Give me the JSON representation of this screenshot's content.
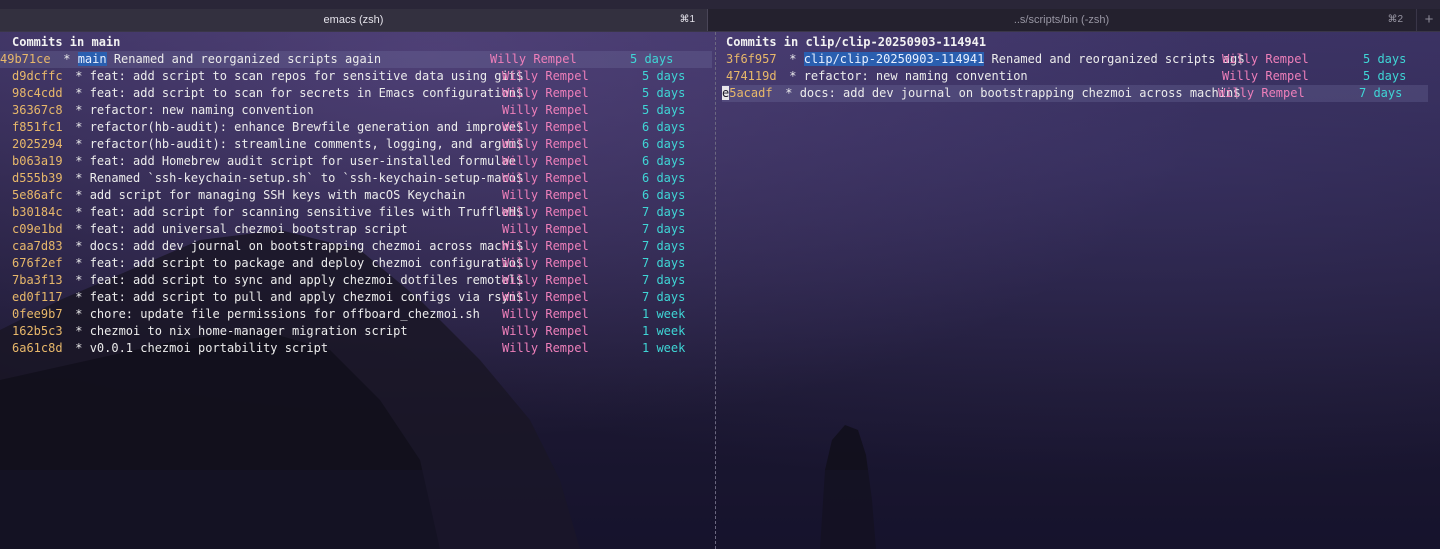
{
  "tabs": [
    {
      "title": "emacs (zsh)",
      "shortcut": "⌘1",
      "active": true
    },
    {
      "title": "..s/scripts/bin (-zsh)",
      "shortcut": "⌘2",
      "active": false
    }
  ],
  "new_tab_label": "+",
  "colors": {
    "hash": "#e8b86a",
    "author": "#ee7fba",
    "age": "#3fd6d6",
    "ref_highlight": "#2a5fb0"
  },
  "left_pane": {
    "header": "Commits in main",
    "rows": [
      {
        "hash": "49b71ce",
        "marker": " * ",
        "ref": "main",
        "message": " Renamed and reorganized scripts again",
        "author": "Willy Rempel",
        "age": "5 days"
      },
      {
        "hash": "d9dcffc",
        "marker": " * ",
        "ref": "",
        "message": "feat: add script to scan repos for sensitive data using git$",
        "author": "Willy Rempel",
        "age": "5 days"
      },
      {
        "hash": "98c4cdd",
        "marker": " * ",
        "ref": "",
        "message": "feat: add script to scan for secrets in Emacs configuration$",
        "author": "Willy Rempel",
        "age": "5 days"
      },
      {
        "hash": "36367c8",
        "marker": " * ",
        "ref": "",
        "message": "refactor: new naming convention",
        "author": "Willy Rempel",
        "age": "5 days"
      },
      {
        "hash": "f851fc1",
        "marker": " * ",
        "ref": "",
        "message": "refactor(hb-audit): enhance Brewfile generation and improve$",
        "author": "Willy Rempel",
        "age": "6 days"
      },
      {
        "hash": "2025294",
        "marker": " * ",
        "ref": "",
        "message": "refactor(hb-audit): streamline comments, logging, and argum$",
        "author": "Willy Rempel",
        "age": "6 days"
      },
      {
        "hash": "b063a19",
        "marker": " * ",
        "ref": "",
        "message": "feat: add Homebrew audit script for user-installed formulae",
        "author": "Willy Rempel",
        "age": "6 days"
      },
      {
        "hash": "d555b39",
        "marker": " * ",
        "ref": "",
        "message": "Renamed `ssh-keychain-setup.sh` to `ssh-keychain-setup-maco$",
        "author": "Willy Rempel",
        "age": "6 days"
      },
      {
        "hash": "5e86afc",
        "marker": " * ",
        "ref": "",
        "message": "add script for managing SSH keys with macOS Keychain",
        "author": "Willy Rempel",
        "age": "6 days"
      },
      {
        "hash": "b30184c",
        "marker": " * ",
        "ref": "",
        "message": "feat: add script for scanning sensitive files with TruffleH$",
        "author": "Willy Rempel",
        "age": "7 days"
      },
      {
        "hash": "c09e1bd",
        "marker": " * ",
        "ref": "",
        "message": "feat: add universal chezmoi bootstrap script",
        "author": "Willy Rempel",
        "age": "7 days"
      },
      {
        "hash": "caa7d83",
        "marker": " * ",
        "ref": "",
        "message": "docs: add dev journal on bootstrapping chezmoi across machi$",
        "author": "Willy Rempel",
        "age": "7 days"
      },
      {
        "hash": "676f2ef",
        "marker": " * ",
        "ref": "",
        "message": "feat: add script to package and deploy chezmoi configuratio$",
        "author": "Willy Rempel",
        "age": "7 days"
      },
      {
        "hash": "7ba3f13",
        "marker": " * ",
        "ref": "",
        "message": "feat: add script to sync and apply chezmoi dotfiles remotel$",
        "author": "Willy Rempel",
        "age": "7 days"
      },
      {
        "hash": "ed0f117",
        "marker": " * ",
        "ref": "",
        "message": "feat: add script to pull and apply chezmoi configs via rsyn$",
        "author": "Willy Rempel",
        "age": "7 days"
      },
      {
        "hash": "0fee9b7",
        "marker": " * ",
        "ref": "",
        "message": "chore: update file permissions for offboard_chezmoi.sh",
        "author": "Willy Rempel",
        "age": "1 week"
      },
      {
        "hash": "162b5c3",
        "marker": " * ",
        "ref": "",
        "message": "chezmoi to nix home-manager migration script",
        "author": "Willy Rempel",
        "age": "1 week"
      },
      {
        "hash": "6a61c8d",
        "marker": " * ",
        "ref": "",
        "message": "v0.0.1 chezmoi portability script",
        "author": "Willy Rempel",
        "age": "1 week"
      }
    ]
  },
  "right_pane": {
    "header": "Commits in clip/clip-20250903-114941",
    "rows": [
      {
        "hash": "3f6f957",
        "marker": " * ",
        "ref": "clip/clip-20250903-114941",
        "message": " Renamed and reorganized scripts ag$",
        "author": "Willy Rempel",
        "age": "5 days"
      },
      {
        "hash": "474119d",
        "marker": " * ",
        "ref": "",
        "message": "refactor: new naming convention",
        "author": "Willy Rempel",
        "age": "5 days"
      },
      {
        "hash": "e5acadf",
        "marker": " * ",
        "ref": "",
        "message": "docs: add dev journal on bootstrapping chezmoi across machin$",
        "author": "Willy Rempel",
        "age": "7 days"
      }
    ]
  }
}
